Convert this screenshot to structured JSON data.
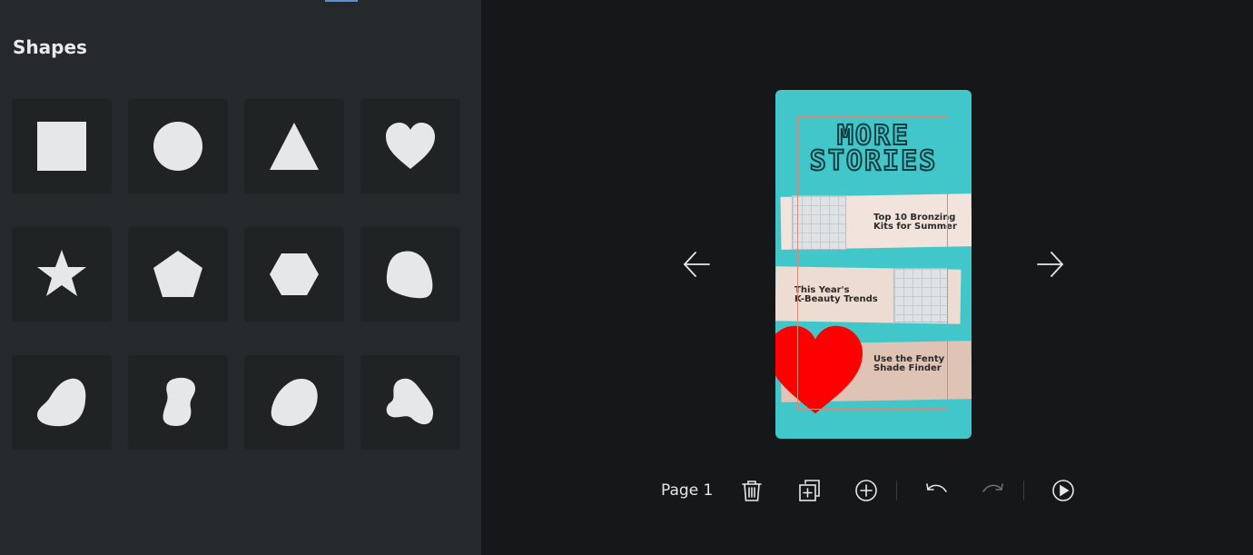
{
  "panel": {
    "title": "Shapes",
    "shapes": [
      {
        "name": "square-icon"
      },
      {
        "name": "circle-icon"
      },
      {
        "name": "triangle-icon"
      },
      {
        "name": "heart-icon"
      },
      {
        "name": "star-icon"
      },
      {
        "name": "pentagon-icon"
      },
      {
        "name": "hexagon-icon"
      },
      {
        "name": "blob-1-icon"
      },
      {
        "name": "blob-2-icon"
      },
      {
        "name": "blob-3-icon"
      },
      {
        "name": "blob-4-icon"
      },
      {
        "name": "blob-5-icon"
      }
    ],
    "shape_color": "#e6e7e9"
  },
  "canvas": {
    "background_color": "#41c6ca",
    "headline_line1": "MORE",
    "headline_line2": "STORIES",
    "stories": [
      {
        "text": "Top 10 Bronzing\nKits for Summer"
      },
      {
        "text": "This Year's\nK-Beauty Trends"
      },
      {
        "text": "Use the Fenty\nShade Finder"
      }
    ],
    "heart_color": "#ff0000"
  },
  "toolbar": {
    "page_label": "Page 1"
  },
  "icons": {
    "prev": "arrow-left-icon",
    "next": "arrow-right-icon",
    "delete": "trash-icon",
    "duplicate": "duplicate-icon",
    "add": "add-circle-icon",
    "undo": "undo-icon",
    "redo": "redo-icon",
    "play": "play-icon"
  }
}
